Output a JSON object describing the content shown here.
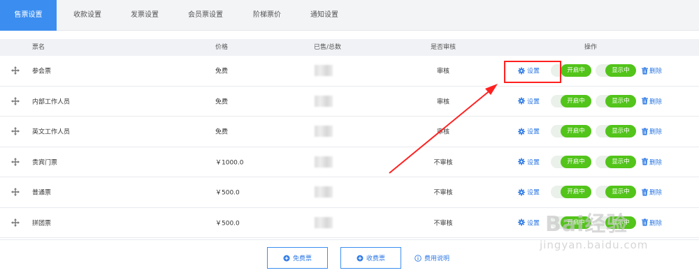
{
  "tabs": [
    {
      "label": "售票设置",
      "active": true
    },
    {
      "label": "收款设置",
      "active": false
    },
    {
      "label": "发票设置",
      "active": false
    },
    {
      "label": "会员票设置",
      "active": false
    },
    {
      "label": "阶梯票价",
      "active": false
    },
    {
      "label": "通知设置",
      "active": false
    }
  ],
  "table": {
    "headers": {
      "name": "票名",
      "price": "价格",
      "sold_total": "已售/总数",
      "audit": "是否审核",
      "actions": "操作"
    },
    "rows": [
      {
        "name": "参会票",
        "price": "免费",
        "audit": "审核"
      },
      {
        "name": "内部工作人员",
        "price": "免费",
        "audit": "审核"
      },
      {
        "name": "英文工作人员",
        "price": "免费",
        "audit": "审核"
      },
      {
        "name": "贵宾门票",
        "price": "￥1000.0",
        "audit": "不审核"
      },
      {
        "name": "普通票",
        "price": "￥500.0",
        "audit": "不审核"
      },
      {
        "name": "拼团票",
        "price": "￥500.0",
        "audit": "不审核"
      }
    ],
    "actions": {
      "settings": "设置",
      "open_state": "开启中",
      "show_state": "显示中",
      "delete": "删除"
    }
  },
  "footer": {
    "free_ticket_button": "免费票",
    "paid_ticket_button": "收费票",
    "fee_info_link": "费用说明"
  },
  "watermark": {
    "logo": "Bai经验",
    "url": "jingyan.baidu.com"
  },
  "colors": {
    "accent": "#3b8ef0",
    "link": "#2f7ae5",
    "toggle_on": "#52c41a",
    "annotation": "#ff2020"
  }
}
